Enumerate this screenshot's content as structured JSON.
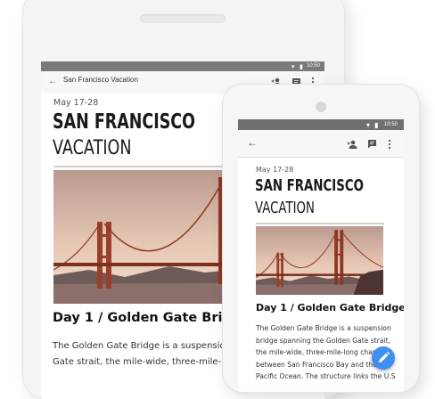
{
  "tablet": {
    "status_time": "10:50",
    "appbar_title": "San Francisco Vacation",
    "date": "May 17-28",
    "headline_line1": "SAN FRANCISCO",
    "headline_line2": "VACATION",
    "section_title": "Day 1 / Golden Gate Bridge",
    "body_line1": "The Golden Gate Bridge is a suspension bridge sp",
    "body_line2": "Gate strait, the mile-wide, three-mile-long channe"
  },
  "phone": {
    "status_time": "10:50",
    "date": "May 17-28",
    "headline_line1": "SAN FRANCISCO",
    "headline_line2": "VACATION",
    "section_title": "Day 1 / Golden Gate Bridge",
    "body_lines": [
      "The Golden Gate Bridge is a suspension",
      "bridge spanning the Golden Gate strait,",
      "the mile-wide, three-mile-long channel",
      "between San Francisco Bay and the",
      "Pacific Ocean. The structure links the U.S"
    ]
  },
  "icons": {
    "back": "arrow-left-icon",
    "share": "person-add-icon",
    "comment": "comment-icon",
    "more": "more-vert-icon",
    "edit": "pencil-icon"
  },
  "colors": {
    "fab": "#3f8ef2",
    "status_bar": "#707070",
    "sky_top": "#d9b6a4",
    "bridge": "#a8412a"
  }
}
